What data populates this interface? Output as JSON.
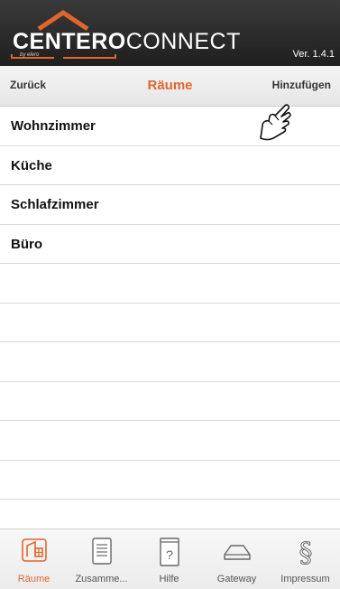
{
  "header": {
    "logo_bold": "CENTERO",
    "logo_light": "CONNECT",
    "logo_by": "by elero",
    "version": "Ver. 1.4.1"
  },
  "navbar": {
    "back_label": "Zurück",
    "title": "Räume",
    "add_label": "Hinzufügen"
  },
  "rooms": [
    "Wohnzimmer",
    "Küche",
    "Schlafzimmer",
    "Büro"
  ],
  "empty_rows": 7,
  "tabs": [
    {
      "label": "Räume",
      "icon": "rooms-icon",
      "active": true
    },
    {
      "label": "Zusamme...",
      "icon": "list-icon",
      "active": false
    },
    {
      "label": "Hilfe",
      "icon": "help-icon",
      "active": false
    },
    {
      "label": "Gateway",
      "icon": "gateway-icon",
      "active": false
    },
    {
      "label": "Impressum",
      "icon": "paragraph-icon",
      "active": false
    }
  ],
  "colors": {
    "accent": "#e0662e",
    "header_bg": "#2b2b2b"
  }
}
